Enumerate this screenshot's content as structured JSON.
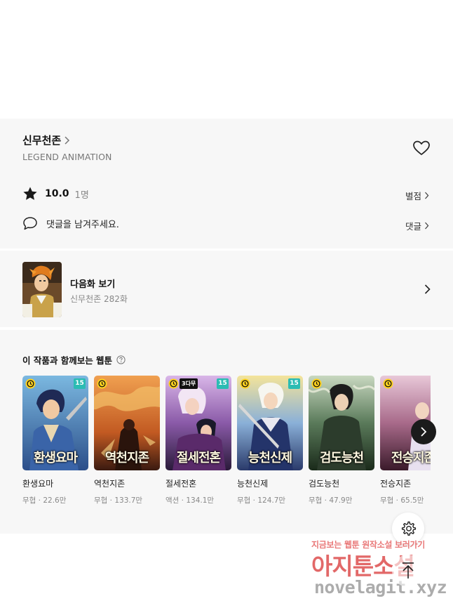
{
  "series": {
    "title": "신무천존",
    "author": "LEGEND ANIMATION"
  },
  "rating": {
    "score": "10.0",
    "count": "1명",
    "rate_link": "별점"
  },
  "comment": {
    "prompt": "댓글을 남겨주세요.",
    "link": "댓글"
  },
  "next_episode": {
    "label": "다음화 보기",
    "subtitle": "신무천존 282화"
  },
  "recommendations": {
    "title": "이 작품과 함께보는 웹툰",
    "items": [
      {
        "name": "환생요마",
        "meta": "무협 · 22.6만",
        "age": "15",
        "wait": "",
        "cover_text": "환생요마"
      },
      {
        "name": "역천지존",
        "meta": "무협 · 133.7만",
        "age": "",
        "wait": "",
        "cover_text": "역천지존"
      },
      {
        "name": "절세전혼",
        "meta": "액션 · 134.1만",
        "age": "15",
        "wait": "3다무",
        "cover_text": "절세전혼"
      },
      {
        "name": "능천신제",
        "meta": "무협 · 124.7만",
        "age": "15",
        "wait": "",
        "cover_text": "능천신제"
      },
      {
        "name": "검도능천",
        "meta": "무협 · 47.9만",
        "age": "",
        "wait": "",
        "cover_text": "검도능천"
      },
      {
        "name": "전승지존",
        "meta": "무협 · 65.5만",
        "age": "",
        "wait": "",
        "cover_text": "전승지존"
      }
    ]
  },
  "watermark": {
    "line1": "지금보는 웹툰 원작소설 보러가기",
    "line2": "아지툰소설",
    "line3": "novelagit.xyz"
  },
  "colors": {
    "section_bg": "#f7f7f7",
    "age_badge": "#2bbcb3",
    "watermark_red": "#d93636"
  },
  "icons": [
    "chevron-right-icon",
    "heart-icon",
    "star-icon",
    "comment-icon",
    "help-icon",
    "clock-icon",
    "gear-icon",
    "arrow-up-icon"
  ]
}
